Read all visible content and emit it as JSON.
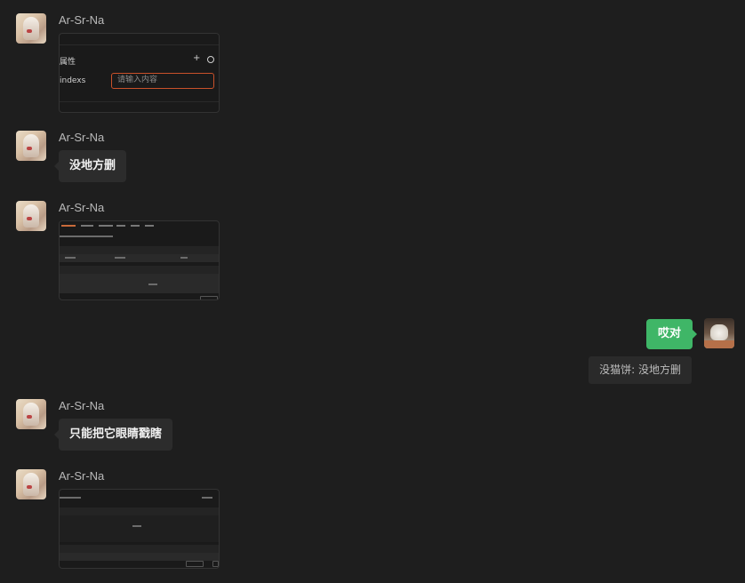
{
  "colors": {
    "background": "#1e1e1e",
    "bubble_left": "#2c2c2c",
    "bubble_right": "#3fb667",
    "input_focus": "#c9512a"
  },
  "messages": [
    {
      "sender": "Ar-Sr-Na",
      "type": "image",
      "screenshot": {
        "title": "属性",
        "field_label": "indexs",
        "placeholder": "请输入内容"
      }
    },
    {
      "sender": "Ar-Sr-Na",
      "type": "text",
      "text": "没地方删"
    },
    {
      "sender": "Ar-Sr-Na",
      "type": "image"
    },
    {
      "sender": "self",
      "type": "text",
      "text": "哎对",
      "quote": "没猫饼: 没地方删"
    },
    {
      "sender": "Ar-Sr-Na",
      "type": "text",
      "text": "只能把它眼睛戳瞎"
    },
    {
      "sender": "Ar-Sr-Na",
      "type": "image"
    }
  ]
}
